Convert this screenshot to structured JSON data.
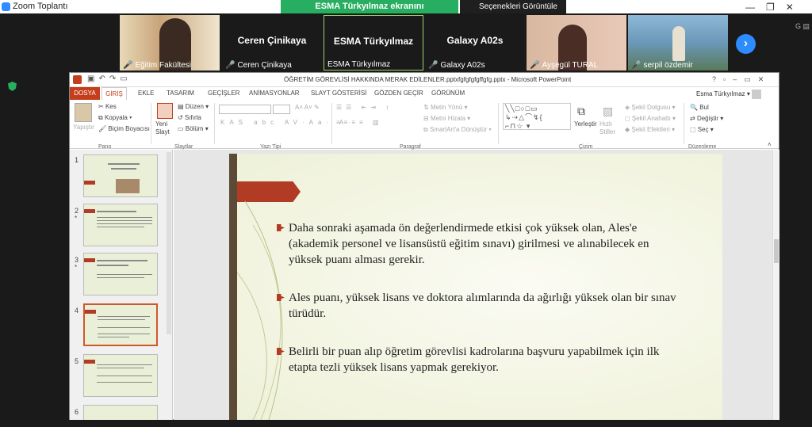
{
  "zoom": {
    "window_title": "Zoom Toplantı",
    "share_banner": "ESMA Türkyılmaz ekranını görüntülüyorsunuz",
    "view_options": "Seçenekleri Görüntüle",
    "participants": [
      {
        "name": "Eğitim Fakültesi",
        "muted": true,
        "video": true
      },
      {
        "name": "Ceren Çinikaya",
        "muted": true,
        "video": false
      },
      {
        "name": "ESMA Türkyılmaz",
        "muted": false,
        "video": false
      },
      {
        "name": "Galaxy A02s",
        "muted": true,
        "video": false
      },
      {
        "name": "Ayşegül TURAL",
        "muted": true,
        "video": true
      },
      {
        "name": "serpil özdemir",
        "muted": true,
        "video": true
      }
    ],
    "next_icon": "chevron-right-icon"
  },
  "ppt": {
    "doc_title": "ÖĞRETİM GÖREVLİSİ HAKKINDA MERAK EDİLENLER.pptxfgfgfgfgffgfg.pptx - Microsoft PowerPoint",
    "tabs": [
      "DOSYA",
      "GİRİŞ",
      "EKLE",
      "TASARIM",
      "GEÇİŞLER",
      "ANİMASYONLAR",
      "SLAYT GÖSTERİSİ",
      "GÖZDEN GEÇİR",
      "GÖRÜNÜM"
    ],
    "user": "Esma Türkyılmaz",
    "ribbon": {
      "groups": [
        "Pano",
        "Slaytlar",
        "Yazı Tipi",
        "Paragraf",
        "Çizim",
        "Düzenleme"
      ],
      "paste": "Yapıştır",
      "cut": "Kes",
      "copy": "Kopyala",
      "format_painter": "Biçim Boyacısı",
      "new_slide": "Yeni Slayt",
      "layout": "Düzen",
      "reset": "Sıfırla",
      "section": "Bölüm",
      "text_direction": "Metin Yönü",
      "align_text": "Metni Hizala",
      "smartart": "SmartArt'a Dönüştür",
      "arrange": "Yerleştir",
      "quick_styles": "Hızlı Stiller",
      "shape_fill": "Şekil Dolgusu",
      "shape_outline": "Şekil Anahattı",
      "shape_effects": "Şekil Efektleri",
      "find": "Bul",
      "replace": "Değiştir",
      "select": "Seç"
    },
    "slides": [
      "1",
      "2",
      "3",
      "4",
      "5",
      "6"
    ],
    "selected_slide": "4",
    "bullets": [
      "Daha sonraki aşamada ön değerlendirmede etkisi çok yüksek olan, Ales'e (akademik personel ve lisansüstü eğitim sınavı) girilmesi ve alınabilecek en yüksek puanı alması gerekir.",
      "Ales puanı, yüksek lisans ve doktora alımlarında da ağırlığı yüksek olan bir sınav türüdür.",
      "Belirli bir puan alıp öğretim görevlisi kadrolarına başvuru yapabilmek için ilk etapta tezli yüksek lisans yapmak gerekiyor."
    ]
  },
  "colors": {
    "accent": "#b13b25",
    "zoom_green": "#27ae60",
    "zoom_blue": "#2d8cff",
    "file_tab": "#c43e1c"
  }
}
